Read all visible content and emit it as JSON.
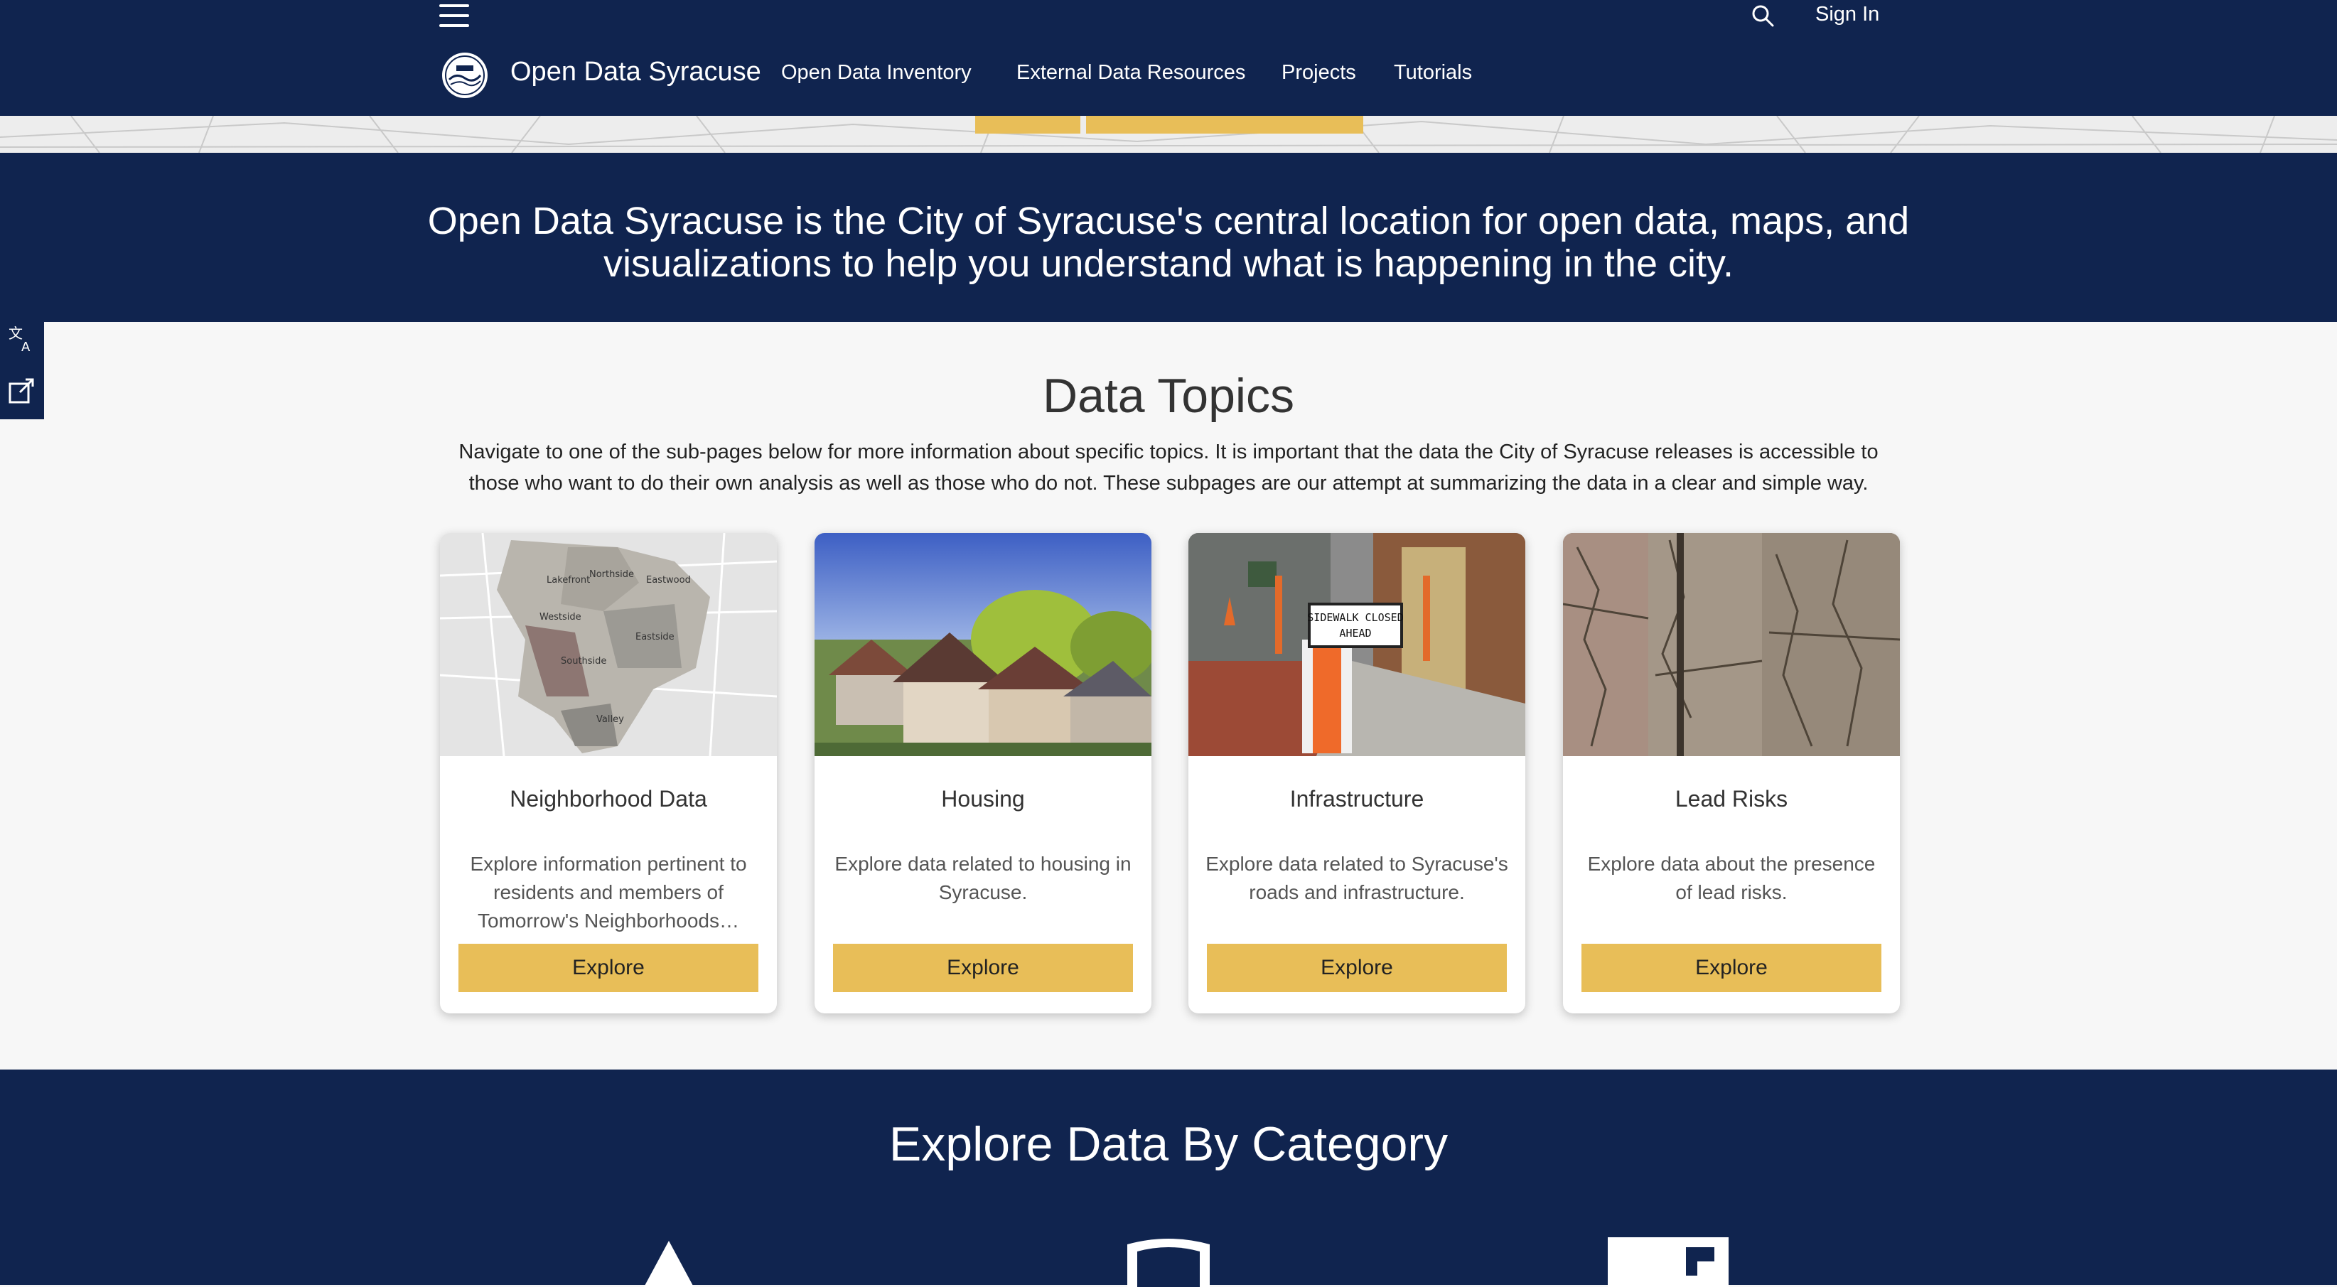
{
  "header": {
    "site_title": "Open Data Syracuse",
    "sign_in": "Sign In",
    "nav": [
      {
        "label": "Open Data Inventory"
      },
      {
        "label": "External Data Resources"
      },
      {
        "label": "Projects"
      },
      {
        "label": "Tutorials"
      }
    ]
  },
  "intro": {
    "text": "Open Data Syracuse is the City of Syracuse's central location for open data, maps, and visualizations to help you understand what is happening in the city."
  },
  "topics": {
    "title": "Data Topics",
    "description": "Navigate to one of the sub-pages below for more information about specific topics. It is important that the data the City of Syracuse releases is accessible to those who want to do their own analysis as well as those who do not. These subpages are our attempt at summarizing the data in a clear and simple way.",
    "cards": [
      {
        "title": "Neighborhood Data",
        "description": "Explore information pertinent to residents and members of Tomorrow's Neighborhoods…",
        "button": "Explore",
        "map_labels": [
          "Lakefront",
          "Northside",
          "Eastwood",
          "Westside",
          "Eastside",
          "Southside",
          "Valley"
        ]
      },
      {
        "title": "Housing",
        "description": "Explore data related to housing in Syracuse.",
        "button": "Explore"
      },
      {
        "title": "Infrastructure",
        "description": "Explore data related to Syracuse's roads and infrastructure.",
        "button": "Explore",
        "sign_text": [
          "SIDEWALK CLOSED",
          "AHEAD"
        ]
      },
      {
        "title": "Lead Risks",
        "description": "Explore data about the presence of lead risks.",
        "button": "Explore"
      }
    ]
  },
  "category": {
    "title": "Explore Data By Category",
    "icons": [
      "tree-icon",
      "police-shield-icon",
      "building-icon"
    ]
  },
  "colors": {
    "navy": "#10244f",
    "gold": "#e8be58",
    "background": "#f7f7f7"
  },
  "side_tools": [
    "translate-icon",
    "share-icon"
  ]
}
